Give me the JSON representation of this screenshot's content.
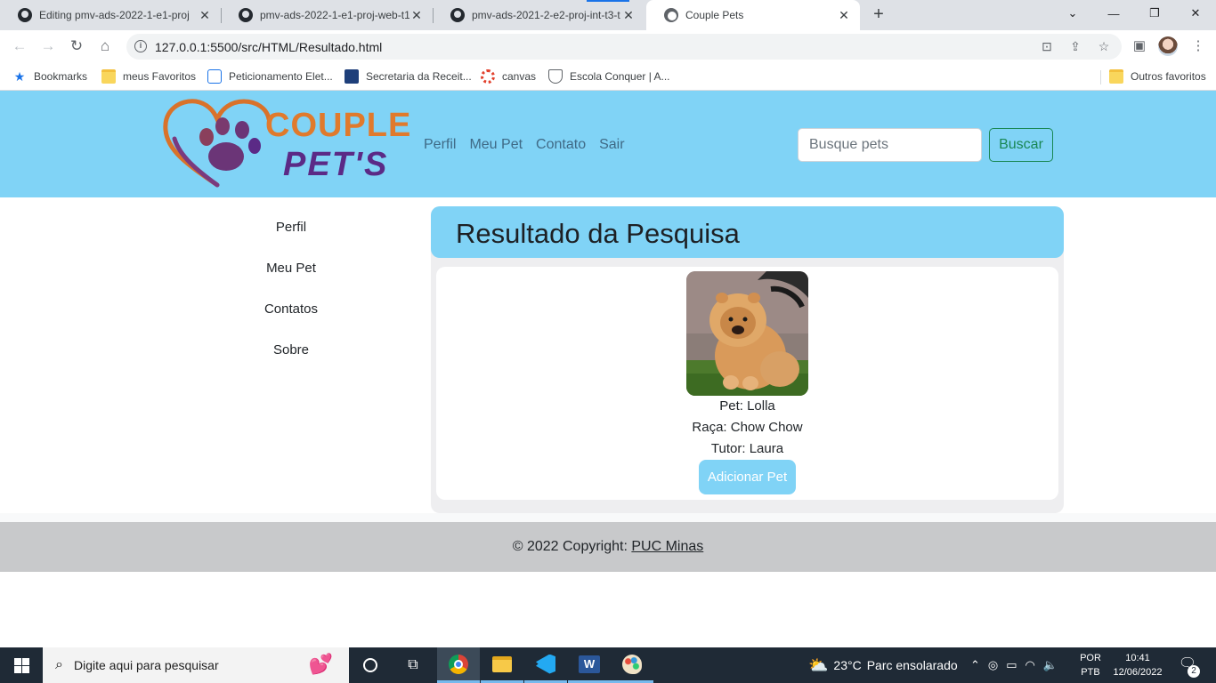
{
  "browser": {
    "tabs": [
      {
        "title": "Editing pmv-ads-2022-1-e1-proj",
        "close": "✕",
        "active": false
      },
      {
        "title": "pmv-ads-2022-1-e1-proj-web-t1",
        "close": "✕",
        "active": false
      },
      {
        "title": "pmv-ads-2021-2-e2-proj-int-t3-t",
        "close": "✕",
        "active": false
      },
      {
        "title": "Couple Pets",
        "close": "✕",
        "active": true
      }
    ],
    "new_tab": "+",
    "window_controls": {
      "tab_search": "⌄",
      "minimize": "—",
      "restore": "❐",
      "close": "✕"
    },
    "nav": {
      "back": "←",
      "forward": "→",
      "reload": "↻",
      "home": "⌂"
    },
    "url": "127.0.0.1:5500/src/HTML/Resultado.html",
    "bookmarks": [
      {
        "label": "Bookmarks",
        "icon": "star-icon"
      },
      {
        "label": "meus Favoritos",
        "icon": "folder-icon"
      },
      {
        "label": "Peticionamento Elet...",
        "icon": "feather-icon"
      },
      {
        "label": "Secretaria da Receit...",
        "icon": "receita-icon"
      },
      {
        "label": "canvas",
        "icon": "canvas-icon"
      },
      {
        "label": "Escola Conquer | A...",
        "icon": "shield-icon"
      }
    ],
    "other_bookmarks": "Outros favoritos"
  },
  "site": {
    "logo": {
      "line1": "COUPLE",
      "line2": "PET'S"
    },
    "nav": [
      "Perfil",
      "Meu Pet",
      "Contato",
      "Sair"
    ],
    "search": {
      "placeholder": "Busque pets",
      "button": "Buscar"
    },
    "sidebar": [
      "Perfil",
      "Meu Pet",
      "Contatos",
      "Sobre"
    ],
    "result": {
      "title": "Resultado da Pesquisa",
      "pet_line": "Pet: Lolla",
      "breed_line": "Raça: Chow Chow",
      "tutor_line": "Tutor: Laura",
      "add_button": "Adicionar Pet"
    },
    "footer": {
      "prefix": "© 2022 Copyright: ",
      "link": "PUC Minas"
    }
  },
  "taskbar": {
    "search_placeholder": "Digite aqui para pesquisar",
    "weather": {
      "temp": "23°C",
      "desc": "Parc ensolarado"
    },
    "language": {
      "line1": "POR",
      "line2": "PTB"
    },
    "clock": {
      "time": "10:41",
      "date": "12/06/2022"
    },
    "notifications": "2"
  },
  "colors": {
    "header_bg": "#80d3f6",
    "search_button": "#198754",
    "footer_bg": "#c8c9cb",
    "taskbar_bg": "#1f2a36"
  }
}
